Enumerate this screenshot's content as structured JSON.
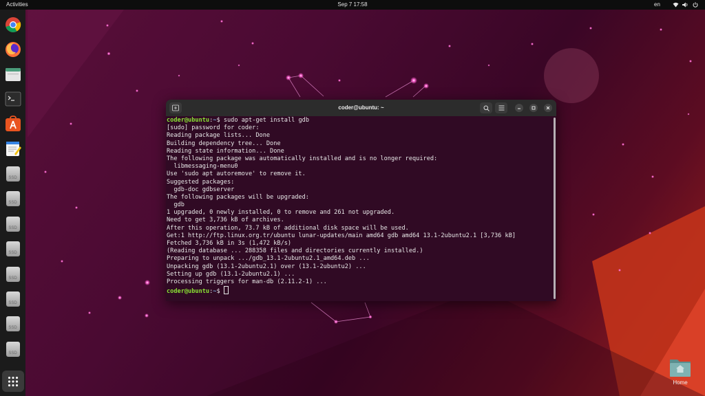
{
  "topbar": {
    "activities": "Activities",
    "clock": "Sep 7  17:58",
    "language": "en",
    "icons": [
      "wifi-icon",
      "volume-icon",
      "power-icon"
    ]
  },
  "dock": {
    "items": [
      "chrome-icon",
      "firefox-icon",
      "files-icon",
      "terminal-icon",
      "app-center-icon",
      "text-editor-icon",
      "ssd-drive-icon",
      "ssd-drive-icon",
      "ssd-drive-icon",
      "ssd-drive-icon",
      "ssd-drive-icon",
      "ssd-drive-icon",
      "ssd-drive-icon",
      "ssd-drive-icon"
    ],
    "ssd_label": "SSD",
    "apps_grid": "show-apps-icon"
  },
  "terminal": {
    "title": "coder@ubuntu: ~",
    "prompt_user": "coder@ubuntu",
    "prompt_sep": ":",
    "prompt_path": "~",
    "prompt_suffix": "$ ",
    "command": "sudo apt-get install gdb",
    "output": [
      "[sudo] password for coder:",
      "Reading package lists... Done",
      "Building dependency tree... Done",
      "Reading state information... Done",
      "The following package was automatically installed and is no longer required:",
      "  libmessaging-menu0",
      "Use 'sudo apt autoremove' to remove it.",
      "Suggested packages:",
      "  gdb-doc gdbserver",
      "The following packages will be upgraded:",
      "  gdb",
      "1 upgraded, 0 newly installed, 0 to remove and 261 not upgraded.",
      "Need to get 3,736 kB of archives.",
      "After this operation, 73.7 kB of additional disk space will be used.",
      "Get:1 http://ftp.linux.org.tr/ubuntu lunar-updates/main amd64 gdb amd64 13.1-2ubuntu2.1 [3,736 kB]",
      "Fetched 3,736 kB in 3s (1,472 kB/s)",
      "(Reading database ... 288358 files and directories currently installed.)",
      "Preparing to unpack .../gdb_13.1-2ubuntu2.1_amd64.deb ...",
      "Unpacking gdb (13.1-2ubuntu2.1) over (13.1-2ubuntu2) ...",
      "Setting up gdb (13.1-2ubuntu2.1) ...",
      "Processing triggers for man-db (2.11.2-1) ..."
    ]
  },
  "desktop": {
    "home_label": "Home"
  },
  "colors": {
    "terminal_bg": "#300a24",
    "prompt_user": "#8ae234",
    "prompt_path": "#729fcf"
  }
}
